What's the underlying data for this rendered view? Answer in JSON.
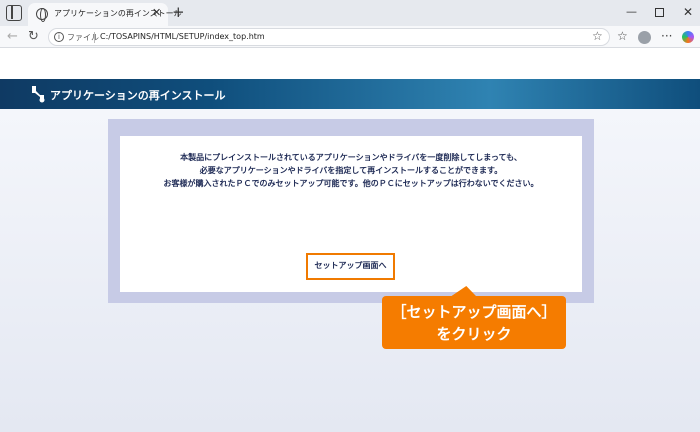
{
  "browser": {
    "tab_title": "アプリケーションの再インストール",
    "tab_close": "✕",
    "new_tab": "+",
    "address_prefix": "ファイル",
    "url": "C:/TOSAPINS/HTML/SETUP/index_top.htm",
    "icons": [
      "sidebar-icon",
      "globe-icon",
      "back-icon",
      "reload-icon",
      "info-icon",
      "star-icon",
      "favorites-icon",
      "profile-icon",
      "more-icon",
      "copilot-icon"
    ]
  },
  "header": {
    "title": "アプリケーションの再インストール",
    "icon": "wrench-icon"
  },
  "main": {
    "message_lines": [
      "本製品にプレインストールされているアプリケーションやドライバを一度削除してしまっても、",
      "必要なアプリケーションやドライバを指定して再インストールすることができます。",
      "お客様が購入されたＰＣでのみセットアップ可能です。他のＰＣにセットアップは行わないでください。"
    ],
    "setup_button_label": "セットアップ画面へ"
  },
  "callout": {
    "line1": "［セットアップ画面へ］",
    "line2": "をクリック",
    "color": "#f57c00"
  }
}
